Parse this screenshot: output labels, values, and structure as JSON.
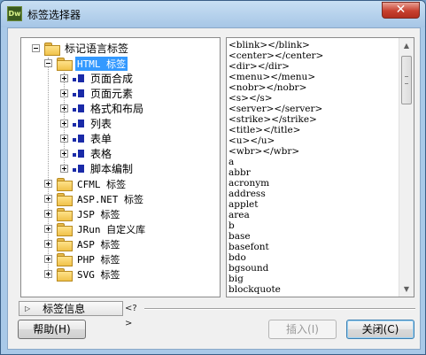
{
  "window": {
    "title": "标签选择器",
    "app_logo": "Dw",
    "close_glyph": "✕"
  },
  "tree": {
    "root": {
      "label": "标记语言标签",
      "expander": "minus",
      "icon": "folder-open-icon"
    },
    "html": {
      "label": "HTML 标签",
      "expander": "minus",
      "icon": "folder-open-icon"
    },
    "html_children": [
      {
        "label": "页面合成"
      },
      {
        "label": "页面元素"
      },
      {
        "label": "格式和布局"
      },
      {
        "label": "列表"
      },
      {
        "label": "表单"
      },
      {
        "label": "表格"
      },
      {
        "label": "脚本编制"
      }
    ],
    "groups": [
      {
        "label": "CFML 标签"
      },
      {
        "label": "ASP.NET 标签"
      },
      {
        "label": "JSP 标签"
      },
      {
        "label": "JRun 自定义库"
      },
      {
        "label": "ASP 标签"
      },
      {
        "label": "PHP 标签"
      },
      {
        "label": "SVG 标签"
      }
    ]
  },
  "tag_list": {
    "items": [
      "<blink></blink>",
      "<center></center>",
      "<dir></dir>",
      "<menu></menu>",
      "<nobr></nobr>",
      "<s></s>",
      "<server></server>",
      "<strike></strike>",
      "<title></title>",
      "<u></u>",
      "<wbr></wbr>",
      "a",
      "abbr",
      "acronym",
      "address",
      "applet",
      "area",
      "b",
      "base",
      "basefont",
      "bdo",
      "bgsound",
      "big",
      "blockquote"
    ],
    "scroll_up_glyph": "▲",
    "scroll_down_glyph": "▼"
  },
  "info_panel": {
    "toggle_label": "标签信息",
    "toggle_glyph": "▷",
    "help_text": "<?>"
  },
  "buttons": {
    "help": "帮助(H)",
    "insert": "插入(I)",
    "close": "关闭(C)"
  }
}
